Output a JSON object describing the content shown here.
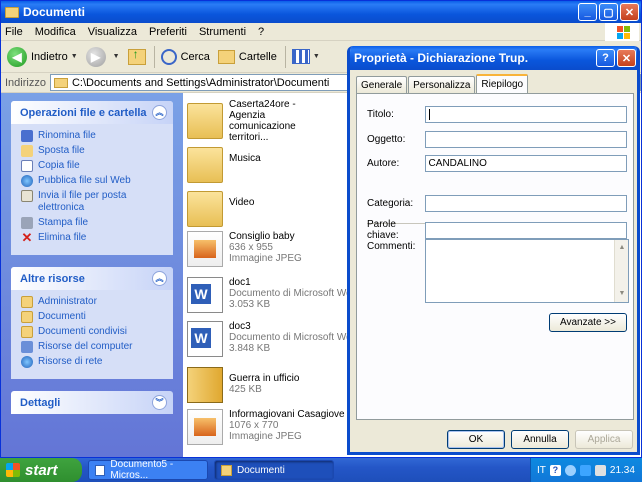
{
  "explorer": {
    "title": "Documenti",
    "menu": [
      "File",
      "Modifica",
      "Visualizza",
      "Preferiti",
      "Strumenti",
      "?"
    ],
    "toolbar": {
      "back": "Indietro",
      "search": "Cerca",
      "folders": "Cartelle"
    },
    "address_label": "Indirizzo",
    "address": "C:\\Documents and Settings\\Administrator\\Documenti"
  },
  "tasks": {
    "file_ops": {
      "title": "Operazioni file e cartella",
      "items": [
        "Rinomina file",
        "Sposta file",
        "Copia file",
        "Pubblica file sul Web",
        "Invia il file per posta elettronica",
        "Stampa file",
        "Elimina file"
      ]
    },
    "other": {
      "title": "Altre risorse",
      "items": [
        "Administrator",
        "Documenti",
        "Documenti condivisi",
        "Risorse del computer",
        "Risorse di rete"
      ]
    },
    "details": {
      "title": "Dettagli"
    }
  },
  "files": [
    {
      "name": "Caserta24ore - Agenzia comunicazione territori...",
      "meta1": "",
      "meta2": "",
      "type": "folder"
    },
    {
      "name": "Musica",
      "meta1": "",
      "meta2": "",
      "type": "folder"
    },
    {
      "name": "Video",
      "meta1": "",
      "meta2": "",
      "type": "folder"
    },
    {
      "name": "Consiglio baby",
      "meta1": "636 x 955",
      "meta2": "Immagine JPEG",
      "type": "jpg"
    },
    {
      "name": "doc1",
      "meta1": "Documento di Microsoft Word",
      "meta2": "3.053 KB",
      "type": "doc"
    },
    {
      "name": "doc3",
      "meta1": "Documento di Microsoft Word",
      "meta2": "3.848 KB",
      "type": "doc"
    },
    {
      "name": "Guerra in ufficio",
      "meta1": "425 KB",
      "meta2": "",
      "type": "zip"
    },
    {
      "name": "Informagiovani Casagiove",
      "meta1": "1076 x 770",
      "meta2": "Immagine JPEG",
      "type": "jpg"
    }
  ],
  "dialog": {
    "title": "Proprietà - Dichiarazione Trup.",
    "tabs": [
      "Generale",
      "Personalizza",
      "Riepilogo"
    ],
    "fields": {
      "titolo_label": "Titolo:",
      "titolo_value": "",
      "oggetto_label": "Oggetto:",
      "oggetto_value": "",
      "autore_label": "Autore:",
      "autore_value": "CANDALINO",
      "categoria_label": "Categoria:",
      "categoria_value": "",
      "parole_label": "Parole chiave:",
      "parole_value": "",
      "commenti_label": "Commenti:"
    },
    "advanced": "Avanzate >>",
    "ok": "OK",
    "cancel": "Annulla",
    "apply": "Applica"
  },
  "taskbar": {
    "start": "start",
    "items": [
      "Documento5 - Micros...",
      "Documenti"
    ],
    "lang": "IT",
    "clock": "21.34"
  }
}
